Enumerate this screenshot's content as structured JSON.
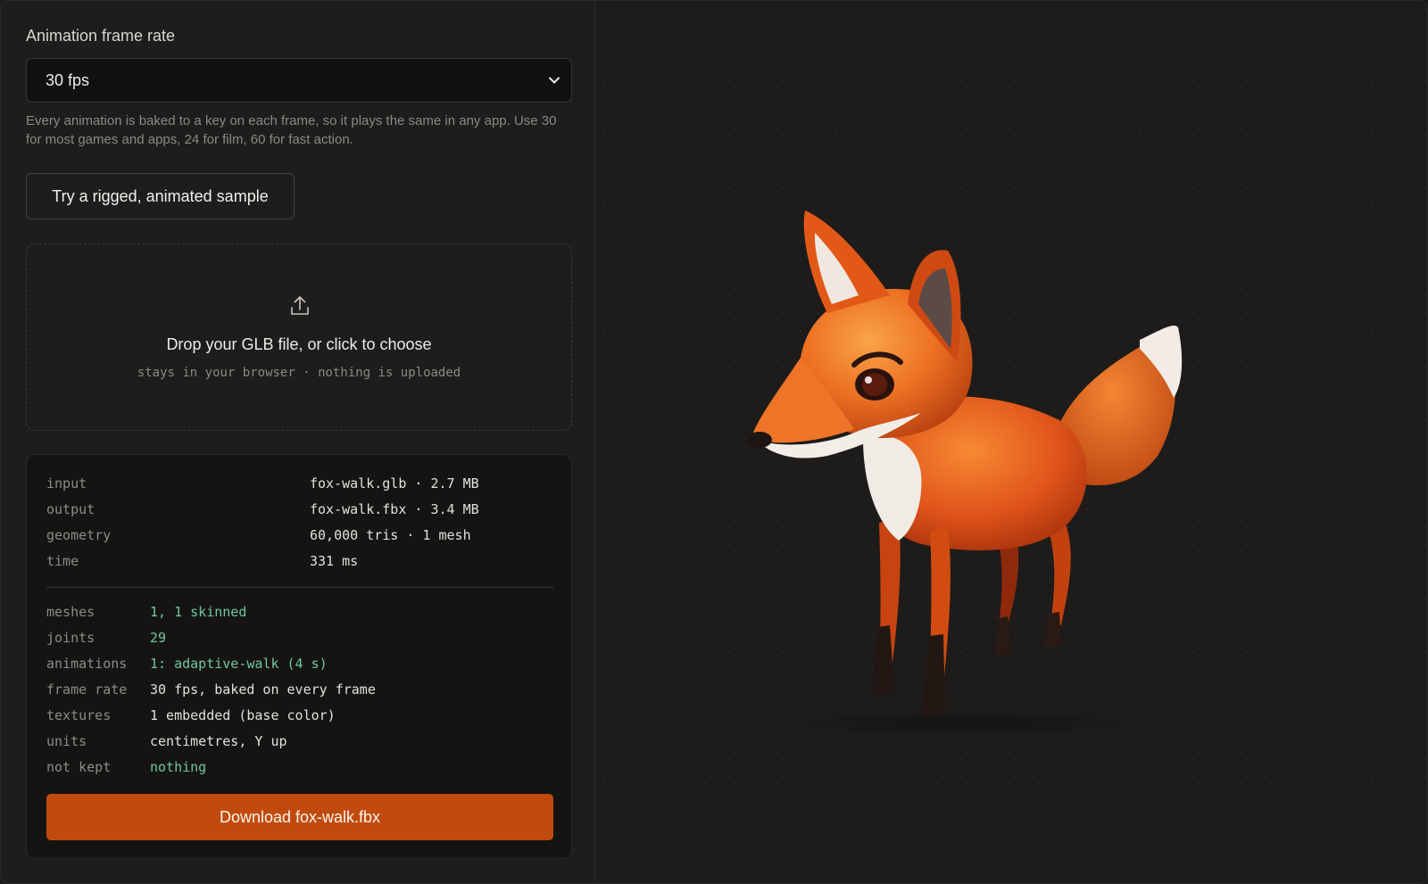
{
  "frame_rate": {
    "label": "Animation frame rate",
    "selected": "30 fps",
    "help": "Every animation is baked to a key on each frame, so it plays the same in any app. Use 30 for most games and apps, 24 for film, 60 for fast action."
  },
  "sample_button": "Try a rigged, animated sample",
  "dropzone": {
    "icon": "upload-icon",
    "title": "Drop your GLB file, or click to choose",
    "subtitle": "stays in your browser · nothing is uploaded"
  },
  "summary": [
    {
      "key": "input",
      "value": "fox-walk.glb · 2.7 MB"
    },
    {
      "key": "output",
      "value": "fox-walk.fbx · 3.4 MB"
    },
    {
      "key": "geometry",
      "value": "60,000 tris · 1 mesh"
    },
    {
      "key": "time",
      "value": "331 ms"
    }
  ],
  "details": [
    {
      "key": "meshes",
      "value": "1, 1 skinned",
      "status": "ok"
    },
    {
      "key": "joints",
      "value": "29",
      "status": "ok"
    },
    {
      "key": "animations",
      "value": "1: adaptive-walk (4 s)",
      "status": "ok"
    },
    {
      "key": "frame rate",
      "value": "30 fps, baked on every frame",
      "status": "plain"
    },
    {
      "key": "textures",
      "value": "1 embedded (base color)",
      "status": "plain"
    },
    {
      "key": "units",
      "value": "centimetres, Y up",
      "status": "plain"
    },
    {
      "key": "not kept",
      "value": "nothing",
      "status": "ok"
    }
  ],
  "download_button": "Download fox-walk.fbx",
  "colors": {
    "accent": "#c14b0e",
    "ok_text": "#6fc7a0",
    "background": "#1d1c1b"
  }
}
